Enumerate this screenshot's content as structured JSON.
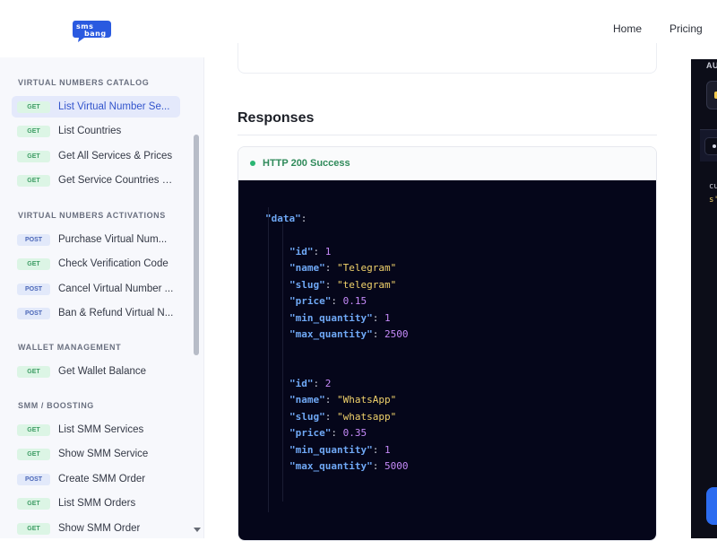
{
  "header": {
    "logo_text": "sms bang",
    "nav": [
      "Home",
      "Pricing"
    ]
  },
  "sidebar": {
    "sections": [
      {
        "title": "VIRTUAL NUMBERS CATALOG",
        "items": [
          {
            "method": "GET",
            "label": "List Virtual Number Se...",
            "active": true
          },
          {
            "method": "GET",
            "label": "List Countries"
          },
          {
            "method": "GET",
            "label": "Get All Services & Prices"
          },
          {
            "method": "GET",
            "label": "Get Service Countries &..."
          }
        ]
      },
      {
        "title": "VIRTUAL NUMBERS ACTIVATIONS",
        "items": [
          {
            "method": "POST",
            "label": "Purchase Virtual Num..."
          },
          {
            "method": "GET",
            "label": "Check Verification Code"
          },
          {
            "method": "POST",
            "label": "Cancel Virtual Number ..."
          },
          {
            "method": "POST",
            "label": "Ban & Refund Virtual N..."
          }
        ]
      },
      {
        "title": "WALLET MANAGEMENT",
        "items": [
          {
            "method": "GET",
            "label": "Get Wallet Balance"
          }
        ]
      },
      {
        "title": "SMM / BOOSTING",
        "items": [
          {
            "method": "GET",
            "label": "List SMM Services"
          },
          {
            "method": "GET",
            "label": "Show SMM Service"
          },
          {
            "method": "POST",
            "label": "Create SMM Order"
          },
          {
            "method": "GET",
            "label": "List SMM Orders"
          },
          {
            "method": "GET",
            "label": "Show SMM Order"
          }
        ]
      }
    ]
  },
  "main": {
    "responses_title": "Responses",
    "status": "HTTP 200 Success",
    "code": {
      "root_key": "\"data\"",
      "items": [
        {
          "id": "1",
          "name": "\"Telegram\"",
          "slug": "\"telegram\"",
          "price": "0.15",
          "min_quantity": "1",
          "max_quantity": "2500"
        },
        {
          "id": "2",
          "name": "\"WhatsApp\"",
          "slug": "\"whatsapp\"",
          "price": "0.35",
          "min_quantity": "1",
          "max_quantity": "5000"
        }
      ]
    }
  },
  "right_panel": {
    "label": "AU",
    "code_line1": "cu",
    "code_line2": "s'"
  },
  "colors": {
    "accent": "#3355cc",
    "success": "#2bb673",
    "code_bg": "#05061a"
  }
}
